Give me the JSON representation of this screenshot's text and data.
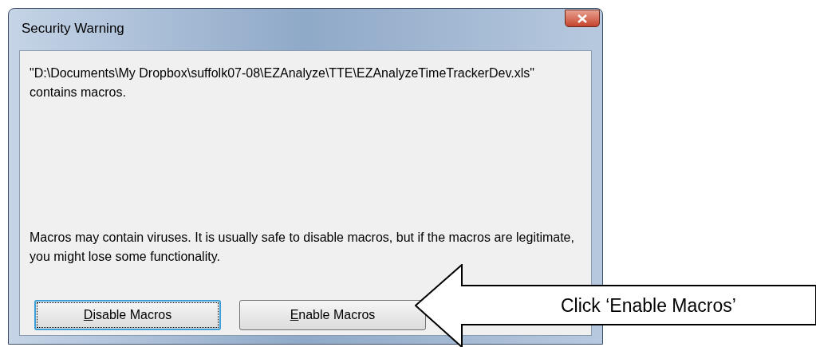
{
  "window": {
    "title": "Security Warning"
  },
  "message": "\"D:\\Documents\\My Dropbox\\suffolk07-08\\EZAnalyze\\TTE\\EZAnalyzeTimeTrackerDev.xls\" contains macros.",
  "warning": "Macros may contain viruses. It is usually safe to disable macros, but if the macros are legitimate, you might lose some functionality.",
  "buttons": [
    {
      "label": "Disable Macros",
      "focused": true
    },
    {
      "label": "Enable Macros",
      "focused": false
    }
  ],
  "callout": {
    "text": "Click ‘Enable Macros’"
  }
}
